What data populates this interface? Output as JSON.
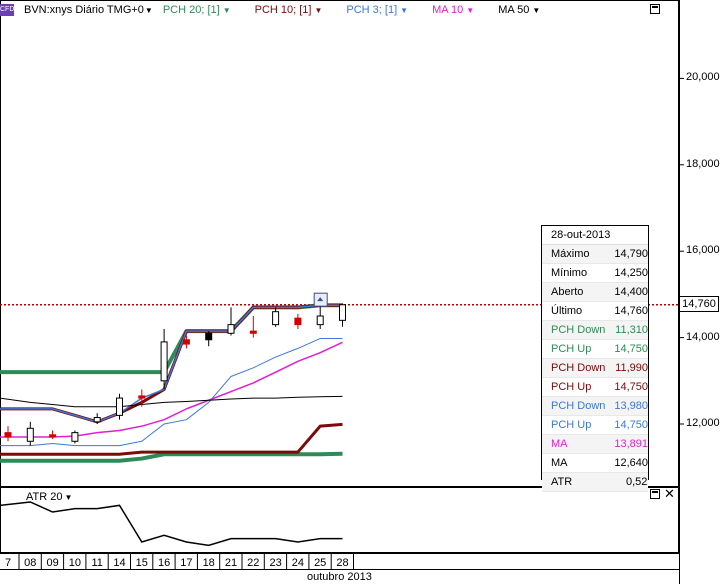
{
  "legend": {
    "symbol": "CFD",
    "instrument": "BVN:xnys Diário TMG+0",
    "items": [
      {
        "label": "PCH 20; [1]",
        "color": "#2e8b57"
      },
      {
        "label": "PCH 10; [1]",
        "color": "#7b0a0a"
      },
      {
        "label": "PCH 3; [1]",
        "color": "#3c78d8"
      },
      {
        "label": "MA 10",
        "color": "#e020d0"
      },
      {
        "label": "MA 50",
        "color": "#000000"
      }
    ]
  },
  "atr_label": "ATR 20",
  "last_price_tag": "14,760",
  "info_panel": {
    "date": "28-out-2013",
    "rows": [
      {
        "key": "Máximo",
        "value": "14,790",
        "color": "#000000"
      },
      {
        "key": "Mínimo",
        "value": "14,250",
        "color": "#000000"
      },
      {
        "key": "Aberto",
        "value": "14,400",
        "color": "#000000"
      },
      {
        "key": "Último",
        "value": "14,760",
        "color": "#000000"
      },
      {
        "key": "PCH Down",
        "value": "11,310",
        "color": "#2e8b57"
      },
      {
        "key": "PCH Up",
        "value": "14,750",
        "color": "#2e8b57"
      },
      {
        "key": "PCH Down",
        "value": "11,990",
        "color": "#7b0a0a"
      },
      {
        "key": "PCH Up",
        "value": "14,750",
        "color": "#7b0a0a"
      },
      {
        "key": "PCH Down",
        "value": "13,980",
        "color": "#3c78d8"
      },
      {
        "key": "PCH Up",
        "value": "14,750",
        "color": "#3c78d8"
      },
      {
        "key": "MA",
        "value": "13,891",
        "color": "#e020d0"
      },
      {
        "key": "MA",
        "value": "12,640",
        "color": "#000000"
      },
      {
        "key": "ATR",
        "value": "0,52",
        "color": "#000000"
      }
    ]
  },
  "chart_data": {
    "type": "candlestick",
    "y_ticks": [
      "12,000",
      "14,000",
      "16,000",
      "18,000",
      "20,000"
    ],
    "y_tick_values": [
      12,
      14,
      16,
      18,
      20
    ],
    "ylim": [
      11.0,
      21.0
    ],
    "last_price": 14.76,
    "x_labels": [
      "7",
      "08",
      "09",
      "10",
      "11",
      "14",
      "15",
      "16",
      "17",
      "18",
      "21",
      "22",
      "23",
      "24",
      "25",
      "28"
    ],
    "month_label": "outubro 2013",
    "candles": [
      {
        "x": "07",
        "open": 11.8,
        "high": 11.95,
        "low": 11.6,
        "close": 11.7,
        "color": "red"
      },
      {
        "x": "08",
        "open": 11.6,
        "high": 12.05,
        "low": 11.5,
        "close": 11.9,
        "color": "white"
      },
      {
        "x": "09",
        "open": 11.75,
        "high": 11.85,
        "low": 11.65,
        "close": 11.7,
        "color": "red"
      },
      {
        "x": "10",
        "open": 11.6,
        "high": 11.85,
        "low": 11.55,
        "close": 11.8,
        "color": "white"
      },
      {
        "x": "11",
        "open": 12.05,
        "high": 12.25,
        "low": 12.0,
        "close": 12.15,
        "color": "white"
      },
      {
        "x": "14",
        "open": 12.2,
        "high": 12.7,
        "low": 12.1,
        "close": 12.6,
        "color": "white"
      },
      {
        "x": "15",
        "open": 12.6,
        "high": 12.8,
        "low": 12.4,
        "close": 12.65,
        "color": "red"
      },
      {
        "x": "16",
        "open": 13.0,
        "high": 14.2,
        "low": 12.8,
        "close": 13.9,
        "color": "white"
      },
      {
        "x": "17",
        "open": 13.95,
        "high": 14.05,
        "low": 13.75,
        "close": 13.85,
        "color": "red"
      },
      {
        "x": "18",
        "open": 14.1,
        "high": 14.15,
        "low": 13.8,
        "close": 13.95,
        "color": "black"
      },
      {
        "x": "21",
        "open": 14.1,
        "high": 14.7,
        "low": 14.05,
        "close": 14.3,
        "color": "white"
      },
      {
        "x": "22",
        "open": 14.15,
        "high": 14.5,
        "low": 14.0,
        "close": 14.1,
        "color": "red"
      },
      {
        "x": "23",
        "open": 14.3,
        "high": 14.7,
        "low": 14.25,
        "close": 14.6,
        "color": "white"
      },
      {
        "x": "24",
        "open": 14.45,
        "high": 14.55,
        "low": 14.2,
        "close": 14.3,
        "color": "red"
      },
      {
        "x": "25",
        "open": 14.3,
        "high": 14.75,
        "low": 14.2,
        "close": 14.5,
        "color": "white"
      },
      {
        "x": "28",
        "open": 14.4,
        "high": 14.79,
        "low": 14.25,
        "close": 14.76,
        "color": "white"
      }
    ],
    "series": [
      {
        "name": "PCH 20 Up",
        "color": "#2e8b57",
        "values": [
          13.2,
          13.2,
          13.2,
          13.2,
          13.2,
          13.2,
          13.2,
          13.2,
          14.15,
          14.15,
          14.15,
          14.7,
          14.7,
          14.7,
          14.75,
          14.75
        ]
      },
      {
        "name": "PCH 20 Down",
        "color": "#2e8b57",
        "values": [
          11.15,
          11.15,
          11.15,
          11.15,
          11.15,
          11.15,
          11.2,
          11.3,
          11.3,
          11.3,
          11.3,
          11.3,
          11.3,
          11.3,
          11.3,
          11.31
        ]
      },
      {
        "name": "PCH 10 Up",
        "color": "#7b0a0a",
        "values": [
          12.35,
          12.35,
          12.35,
          12.2,
          12.05,
          12.25,
          12.5,
          12.8,
          14.15,
          14.15,
          14.15,
          14.7,
          14.7,
          14.7,
          14.75,
          14.75
        ]
      },
      {
        "name": "PCH 10 Down",
        "color": "#7b0a0a",
        "values": [
          11.3,
          11.3,
          11.3,
          11.3,
          11.3,
          11.3,
          11.35,
          11.35,
          11.35,
          11.35,
          11.35,
          11.35,
          11.35,
          11.35,
          11.95,
          11.99
        ]
      },
      {
        "name": "PCH 3 Up",
        "color": "#3c78d8",
        "values": [
          12.35,
          12.35,
          12.35,
          12.2,
          12.05,
          12.25,
          12.6,
          12.8,
          14.15,
          14.15,
          14.15,
          14.7,
          14.7,
          14.7,
          14.75,
          14.75
        ]
      },
      {
        "name": "PCH 3 Down",
        "color": "#3c78d8",
        "values": [
          11.5,
          11.5,
          11.55,
          11.5,
          11.5,
          11.5,
          11.6,
          12.0,
          12.1,
          12.5,
          13.1,
          13.3,
          13.55,
          13.75,
          13.98,
          13.98
        ]
      },
      {
        "name": "MA 10",
        "color": "#e020d0",
        "values": [
          11.7,
          11.7,
          11.7,
          11.72,
          11.8,
          11.85,
          11.95,
          12.1,
          12.35,
          12.55,
          12.75,
          12.95,
          13.2,
          13.45,
          13.65,
          13.891
        ]
      },
      {
        "name": "MA 50",
        "color": "#000000",
        "values": [
          12.6,
          12.5,
          12.45,
          12.4,
          12.4,
          12.4,
          12.45,
          12.5,
          12.52,
          12.55,
          12.58,
          12.6,
          12.6,
          12.62,
          12.63,
          12.64
        ]
      }
    ],
    "atr": {
      "name": "ATR 20",
      "values": [
        0.62,
        0.63,
        0.6,
        0.61,
        0.61,
        0.62,
        0.51,
        0.53,
        0.51,
        0.5,
        0.52,
        0.52,
        0.52,
        0.51,
        0.52,
        0.52
      ],
      "current": "0,52",
      "ylim": [
        0.48,
        0.66
      ]
    }
  }
}
